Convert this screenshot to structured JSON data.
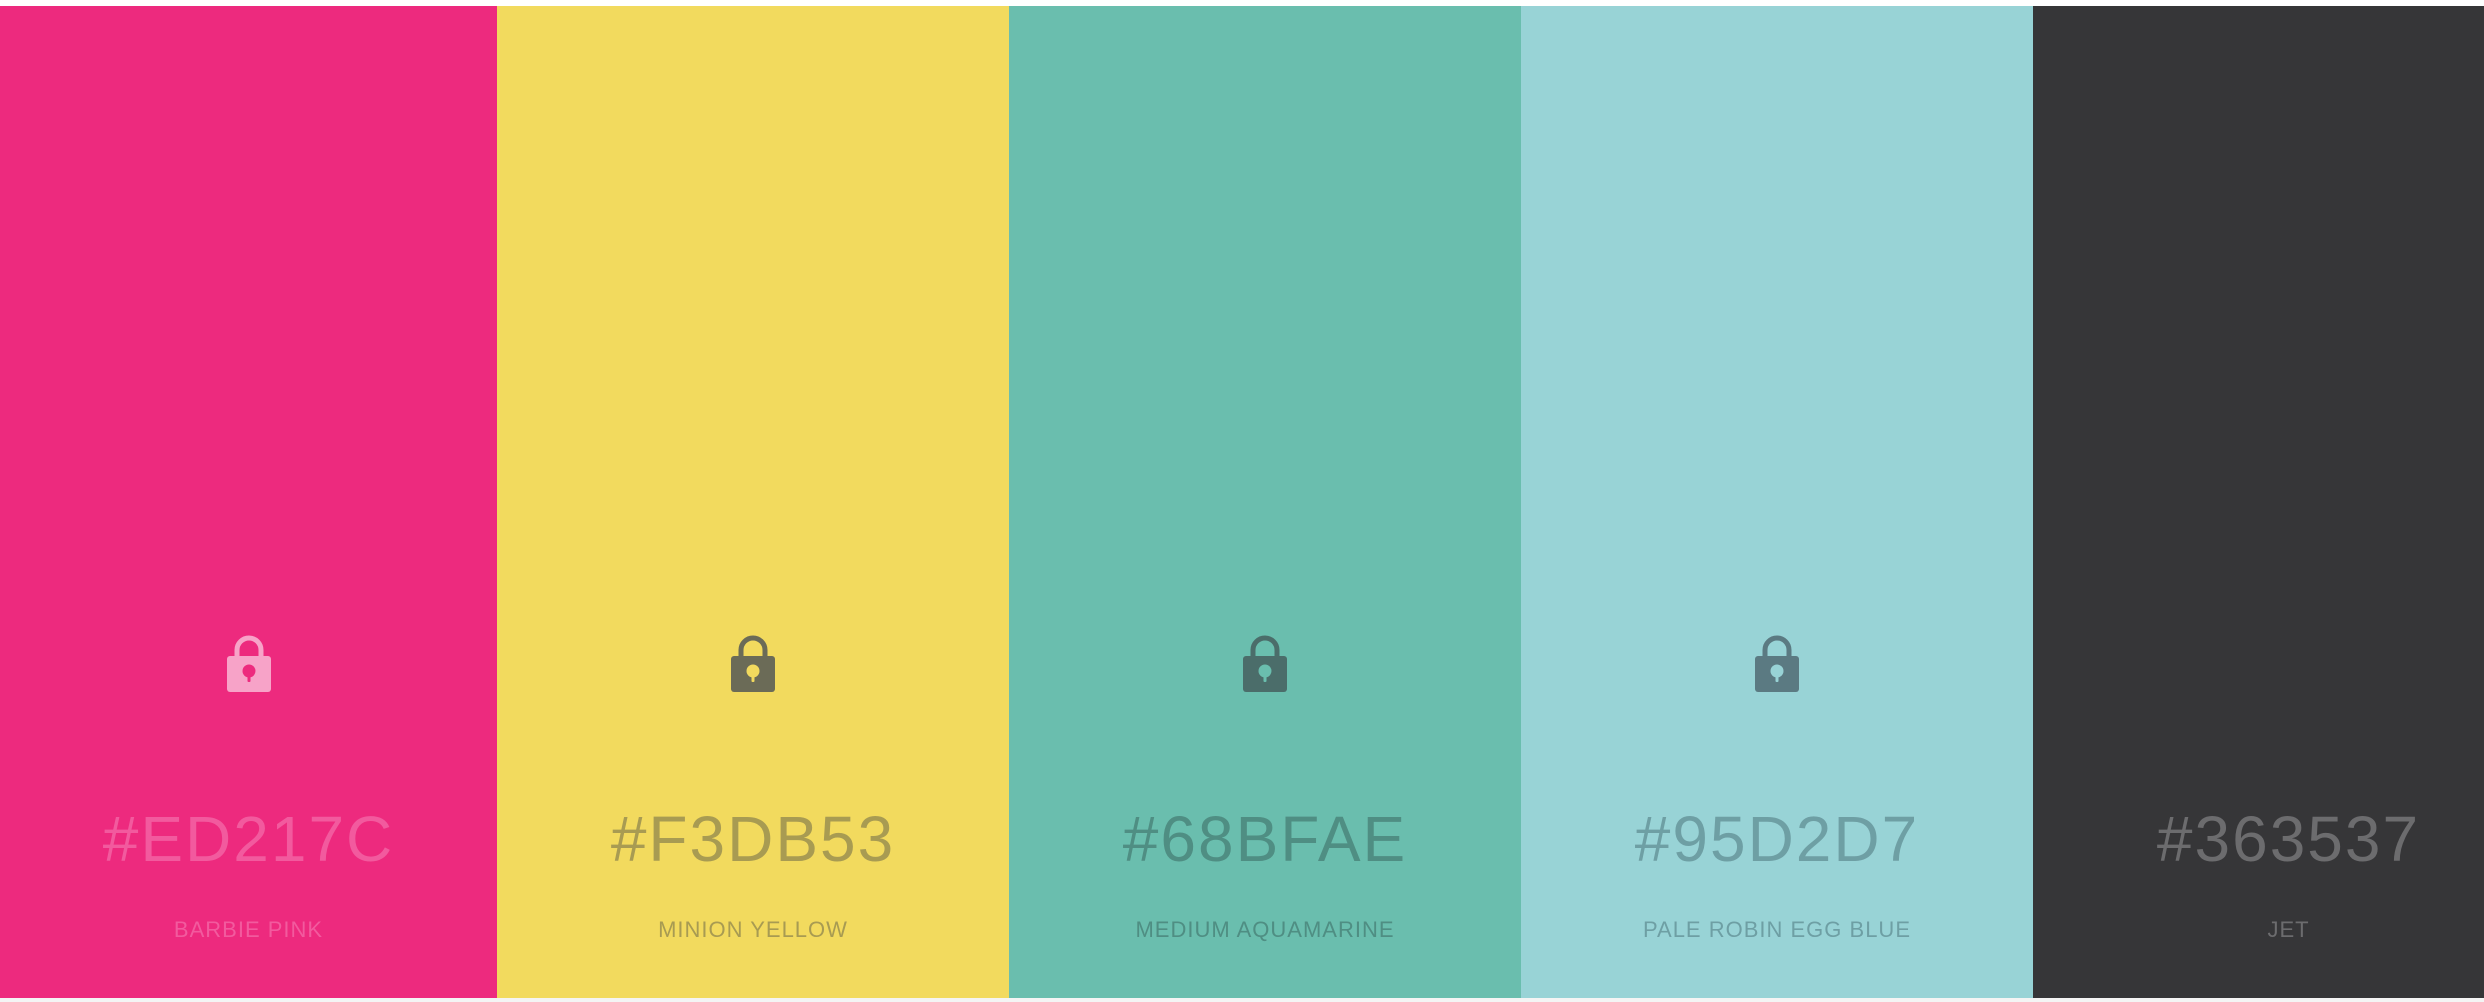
{
  "palette": {
    "colors": [
      {
        "hex": "#ED217C",
        "name": "BARBIE PINK",
        "bg": "#ED2A7E",
        "text_color": "#F25A9E",
        "lock_color": "#F7A3C8",
        "lock_hole_color": "#ED2A7E",
        "locked": false,
        "icon": "lock-icon"
      },
      {
        "hex": "#F3DB53",
        "name": "MINION YELLOW",
        "bg": "#F2DA5E",
        "text_color": "#A89B52",
        "lock_color": "#6B6B57",
        "lock_hole_color": "#F2DA5E",
        "locked": false,
        "icon": "lock-icon"
      },
      {
        "hex": "#68BFAE",
        "name": "MEDIUM AQUAMARINE",
        "bg": "#6ABEAE",
        "text_color": "#4F8E83",
        "lock_color": "#4B6D6A",
        "lock_hole_color": "#6ABEAE",
        "locked": false,
        "icon": "lock-icon"
      },
      {
        "hex": "#95D2D7",
        "name": "PALE ROBIN EGG BLUE",
        "bg": "#98D3D6",
        "text_color": "#6E9FA4",
        "lock_color": "#5B7A82",
        "lock_hole_color": "#98D3D6",
        "locked": false,
        "icon": "lock-icon"
      },
      {
        "hex": "#363537",
        "name": "JET",
        "bg": "#363638",
        "text_color": "#6C6C6E",
        "lock_color": null,
        "lock_hole_color": null,
        "locked": false,
        "icon": null
      }
    ]
  }
}
